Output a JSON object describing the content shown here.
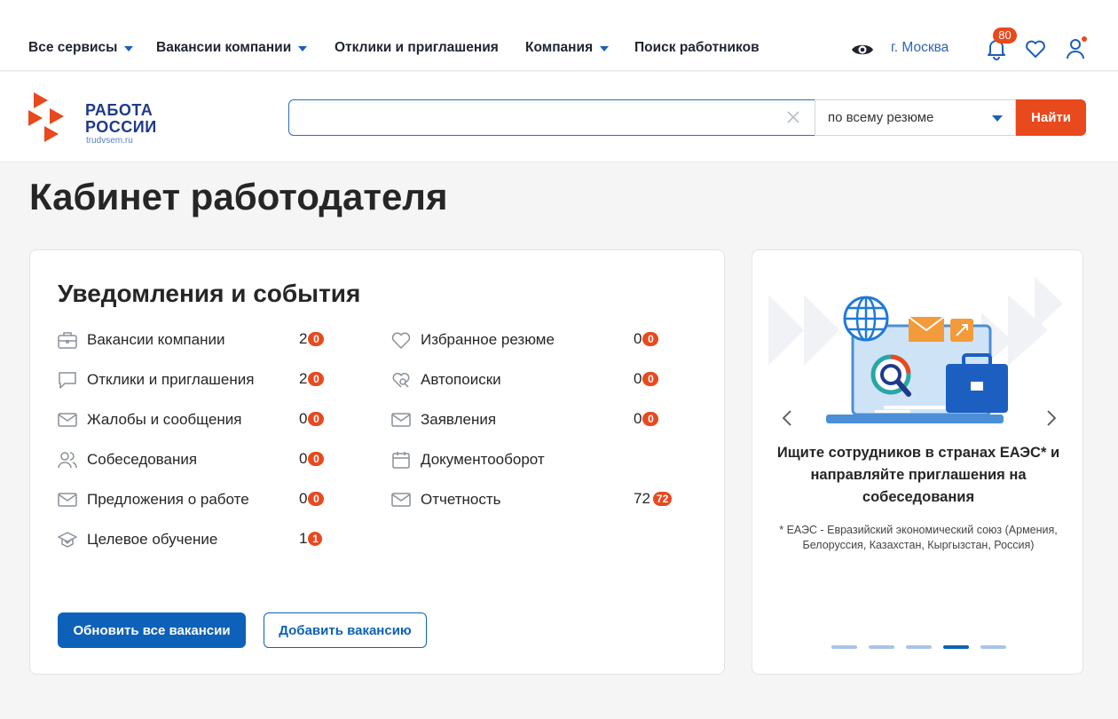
{
  "topnav": {
    "items": [
      {
        "label": "Все сервисы",
        "dropdown": true
      },
      {
        "label": "Вакансии компании",
        "dropdown": true
      },
      {
        "label": "Отклики и приглашения",
        "dropdown": false
      },
      {
        "label": "Компания",
        "dropdown": true
      },
      {
        "label": "Поиск работников",
        "dropdown": false
      }
    ],
    "city": "г. Москва",
    "notifications_count": "80"
  },
  "logo": {
    "line1": "РАБОТА",
    "line2": "РОССИИ",
    "domain": "trudvsem.ru"
  },
  "search": {
    "value": "",
    "placeholder": "",
    "scope_selected": "по всему резюме",
    "submit_label": "Найти"
  },
  "page_title": "Кабинет работодателя",
  "notifications": {
    "title": "Уведомления и события",
    "left": [
      {
        "label": "Вакансии компании",
        "count": "2",
        "badge": "0",
        "icon": "briefcase-icon"
      },
      {
        "label": "Отклики и приглашения",
        "count": "2",
        "badge": "0",
        "icon": "chat-bubble-icon"
      },
      {
        "label": "Жалобы и сообщения",
        "count": "0",
        "badge": "0",
        "icon": "envelope-icon"
      },
      {
        "label": "Собеседования",
        "count": "0",
        "badge": "0",
        "icon": "people-icon"
      },
      {
        "label": "Предложения о работе",
        "count": "0",
        "badge": "0",
        "icon": "envelope-icon"
      },
      {
        "label": "Целевое обучение",
        "count": "1",
        "badge": "1",
        "icon": "graduation-icon"
      }
    ],
    "right": [
      {
        "label": "Избранное резюме",
        "count": "0",
        "badge": "0",
        "icon": "heart-icon"
      },
      {
        "label": "Автопоиски",
        "count": "0",
        "badge": "0",
        "icon": "auto-search-icon"
      },
      {
        "label": "Заявления",
        "count": "0",
        "badge": "0",
        "icon": "envelope-icon"
      },
      {
        "label": "Документооборот",
        "count": "",
        "badge": "",
        "icon": "calendar-icon"
      },
      {
        "label": "Отчетность",
        "count": "72",
        "badge": "72",
        "icon": "envelope-icon"
      }
    ],
    "update_button": "Обновить все вакансии",
    "add_button": "Добавить вакансию"
  },
  "promo": {
    "title": "Ищите сотрудников в странах ЕАЭС* и направляйте приглашения на собеседования",
    "note": "* ЕАЭС - Евразийский экономический союз (Армения, Белоруссия, Казахстан, Кыргызстан, Россия)",
    "slides_total": 5,
    "active_slide": 4
  },
  "colors": {
    "accent": "#e8491d",
    "primary": "#0d61b8",
    "brand_dark": "#1f3a8a"
  }
}
